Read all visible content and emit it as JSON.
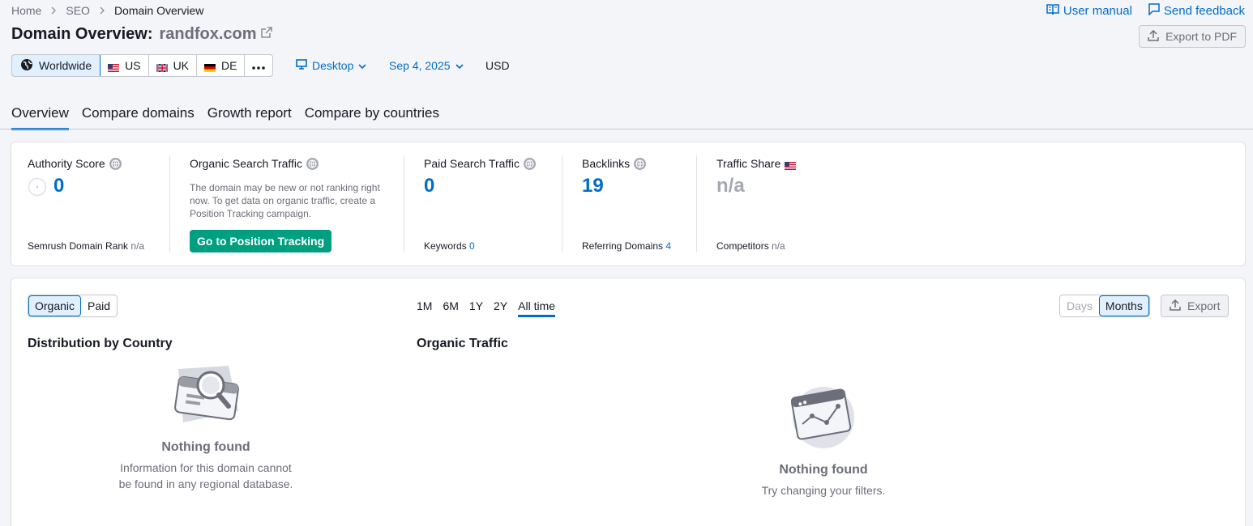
{
  "breadcrumb": {
    "items": [
      "Home",
      "SEO",
      "Domain Overview"
    ]
  },
  "toplinks": {
    "manual": "User manual",
    "feedback": "Send feedback"
  },
  "title": {
    "prefix": "Domain Overview:",
    "domain": "randfox.com"
  },
  "export_pdf": "Export to PDF",
  "databases": [
    {
      "label": "Worldwide",
      "icon": "globe-icon",
      "active": true
    },
    {
      "label": "US",
      "icon": "us-flag-icon"
    },
    {
      "label": "UK",
      "icon": "uk-flag-icon"
    },
    {
      "label": "DE",
      "icon": "de-flag-icon"
    }
  ],
  "more_icon": "more-dots-icon",
  "device": "Desktop",
  "date": "Sep 4, 2025",
  "currency": "USD",
  "tabs": [
    "Overview",
    "Compare domains",
    "Growth report",
    "Compare by countries"
  ],
  "summary": {
    "authority": {
      "label": "Authority Score",
      "value": "0",
      "foot_label": "Semrush Domain Rank",
      "foot_value": "n/a"
    },
    "organic": {
      "label": "Organic Search Traffic",
      "desc": "The domain may be new or not ranking right now. To get data on organic traffic, create a Position Tracking campaign.",
      "button": "Go to Position Tracking"
    },
    "paid": {
      "label": "Paid Search Traffic",
      "value": "0",
      "foot_label": "Keywords",
      "foot_value": "0"
    },
    "backlinks": {
      "label": "Backlinks",
      "value": "19",
      "foot_label": "Referring Domains",
      "foot_value": "4"
    },
    "share": {
      "label": "Traffic Share",
      "value": "n/a",
      "foot_label": "Competitors",
      "foot_value": "n/a"
    }
  },
  "lower": {
    "source_toggle": [
      "Organic",
      "Paid"
    ],
    "periods": [
      "1M",
      "6M",
      "1Y",
      "2Y",
      "All time"
    ],
    "active_period": "All time",
    "granularity": [
      "Days",
      "Months"
    ],
    "export": "Export",
    "distribution": {
      "title": "Distribution by Country",
      "empty_title": "Nothing found",
      "empty_text_1": "Information for this domain cannot",
      "empty_text_2": "be found in any regional database."
    },
    "traffic": {
      "title": "Organic Traffic",
      "empty_title": "Nothing found",
      "empty_text": "Try changing your filters."
    }
  }
}
